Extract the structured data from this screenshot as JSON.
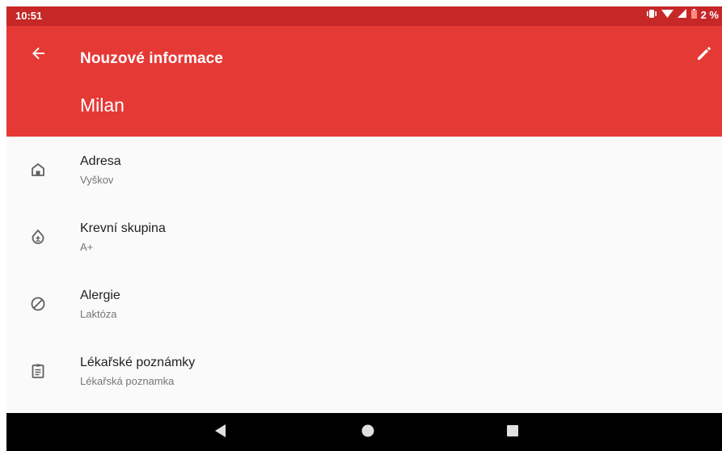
{
  "status_bar": {
    "time": "10:51",
    "battery": "2 %",
    "icons": [
      "vibrate-icon",
      "wifi-icon",
      "signal-icon",
      "battery-icon"
    ]
  },
  "app_bar": {
    "title": "Nouzové informace",
    "name": "Milan",
    "back_icon": "arrow-back-icon",
    "edit_icon": "pencil-icon",
    "colors": {
      "status": "#c62828",
      "toolbar": "#e53935"
    }
  },
  "items": [
    {
      "label": "Adresa",
      "value": "Vyškov",
      "icon": "home-icon"
    },
    {
      "label": "Krevní skupina",
      "value": "A+",
      "icon": "blood-drop-icon"
    },
    {
      "label": "Alergie",
      "value": "Laktóza",
      "icon": "block-icon"
    },
    {
      "label": "Lékařské poznámky",
      "value": "Lékařská poznamka",
      "icon": "clipboard-icon"
    }
  ],
  "nav_bar": {
    "buttons": [
      "back-triangle-icon",
      "home-circle-icon",
      "recents-square-icon"
    ]
  }
}
